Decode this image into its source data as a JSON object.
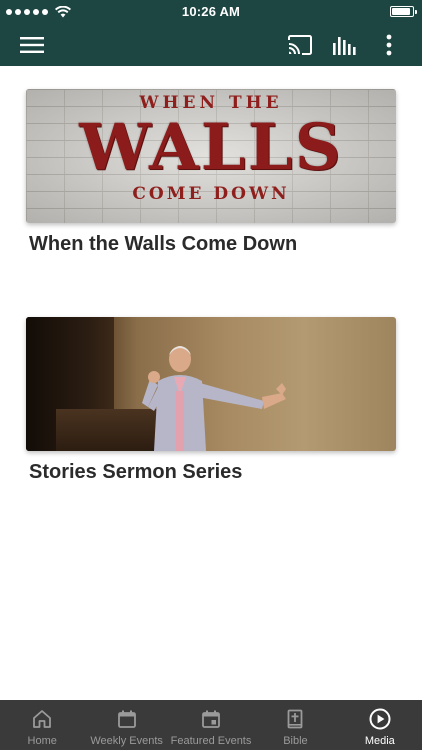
{
  "status_bar": {
    "signal_dots": 5,
    "time": "10:26 AM",
    "battery_level": 0.92,
    "icons": [
      "signal-dots-icon",
      "wifi-icon",
      "battery-icon"
    ]
  },
  "app_bar": {
    "background_color": "#1d4643",
    "icons": [
      "menu-icon",
      "cast-icon",
      "equalizer-icon",
      "more-vertical-icon"
    ]
  },
  "media": {
    "series": [
      {
        "title": "When the Walls Come Down",
        "art": {
          "line_top": "WHEN THE",
          "line_main": "WALLS",
          "line_bottom": "COME DOWN"
        }
      },
      {
        "title": "Stories Sermon Series"
      }
    ]
  },
  "bottom_nav": {
    "active": "Media",
    "items": [
      {
        "label": "Home",
        "icon": "home-icon"
      },
      {
        "label": "Weekly Events",
        "icon": "calendar-icon"
      },
      {
        "label": "Featured Events",
        "icon": "calendar-event-icon"
      },
      {
        "label": "Bible",
        "icon": "bible-icon"
      },
      {
        "label": "Media",
        "icon": "play-circle-icon"
      }
    ]
  }
}
